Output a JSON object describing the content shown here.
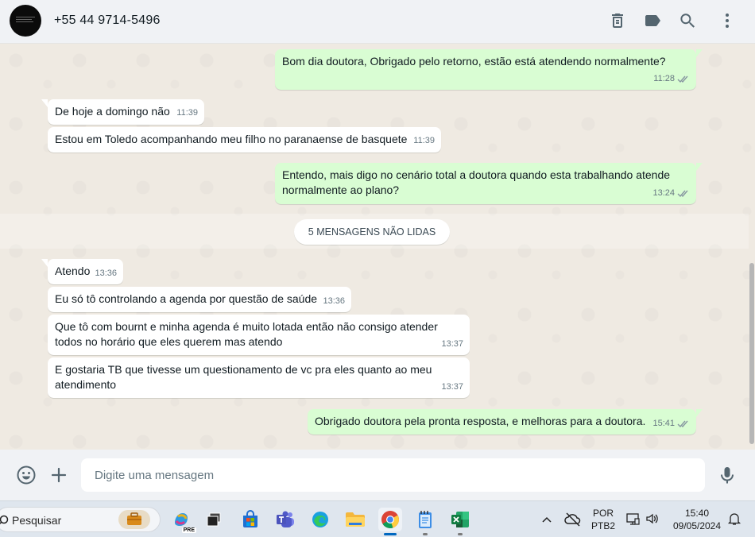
{
  "contact": {
    "name": "+55 44 9714-5496"
  },
  "messages": [
    {
      "dir": "out",
      "text": "Bom dia doutora, Obrigado pelo retorno, estão está atendendo normalmente?",
      "time": "11:28"
    },
    {
      "dir": "in",
      "text": "De hoje a domingo não",
      "time": "11:39"
    },
    {
      "dir": "in",
      "text": "Estou em Toledo acompanhando meu filho no paranaense de basquete",
      "time": "11:39"
    },
    {
      "dir": "out",
      "text": "Entendo, mais digo no cenário total a doutora quando esta trabalhando atende normalmente ao plano?",
      "time": "13:24"
    },
    {
      "dir": "in",
      "text": "Atendo",
      "time": "13:36"
    },
    {
      "dir": "in",
      "text": "Eu só tô controlando a agenda por questão de saúde",
      "time": "13:36"
    },
    {
      "dir": "in",
      "text": "Que tô com bournt e minha agenda é muito lotada então não consigo atender todos no horário que eles querem mas atendo",
      "time": "13:37"
    },
    {
      "dir": "in",
      "text": "E gostaria TB que tivesse um questionamento de vc pra eles quanto ao meu atendimento",
      "time": "13:37"
    },
    {
      "dir": "out",
      "text": "Obrigado doutora pela pronta resposta, e melhoras para a doutora.",
      "time": "15:41"
    }
  ],
  "unread_label": "5 MENSAGENS NÃO LIDAS",
  "composer": {
    "placeholder": "Digite uma mensagem"
  },
  "taskbar": {
    "search_label": "Pesquisar",
    "pre_badge": "PRE",
    "lang_line1": "POR",
    "lang_line2": "PTB2",
    "clock_time": "15:40",
    "clock_date": "09/05/2024"
  },
  "colors": {
    "outgoing": "#d9fdd3",
    "incoming": "#ffffff",
    "chat_bg": "#efeae2",
    "read_ticks": "#53bdeb",
    "header_bg": "#f0f2f5"
  },
  "icons": {
    "header": [
      "delete-icon",
      "label-icon",
      "search-icon",
      "menu-icon"
    ],
    "composer": [
      "emoji-icon",
      "plus-icon",
      "mic-icon"
    ]
  }
}
